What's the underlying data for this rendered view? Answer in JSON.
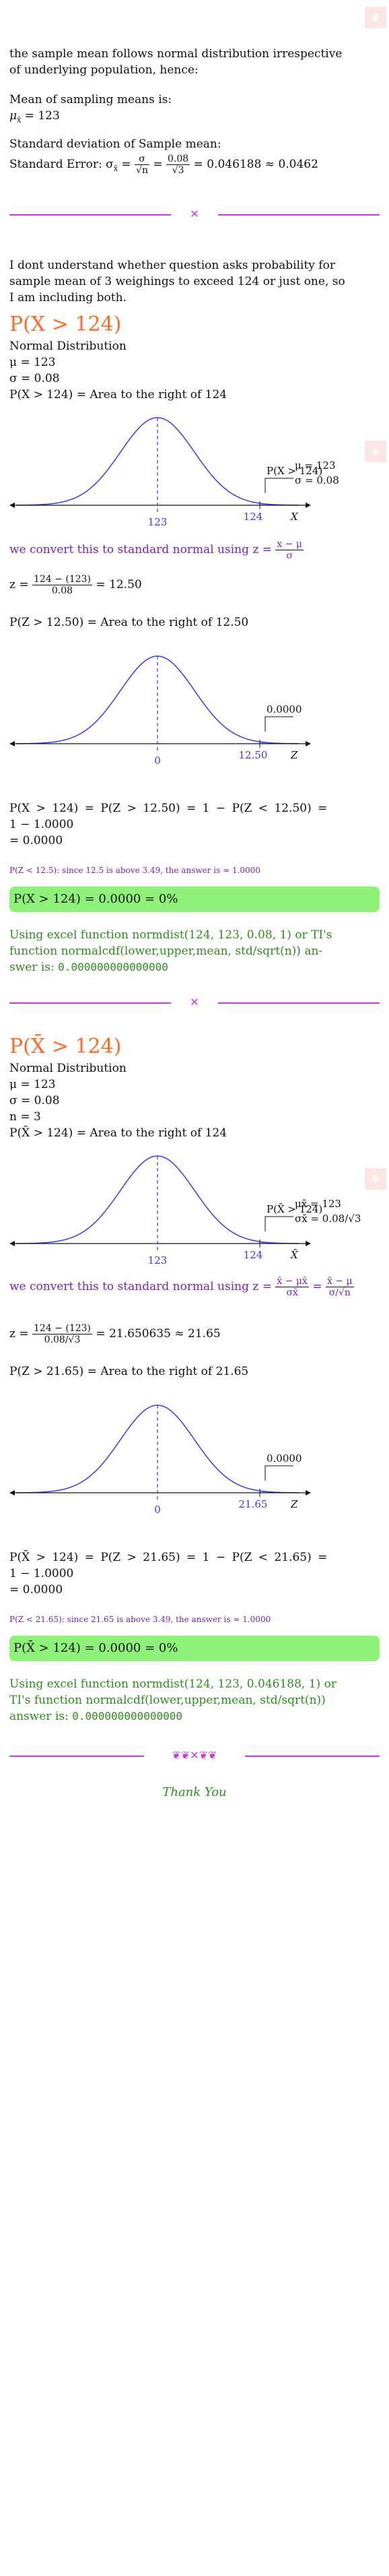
{
  "intro": {
    "line1": "the sample mean follows normal distribution irrespective",
    "line2": "of underlying population, hence:",
    "mean_label": "Mean of sampling means is:",
    "mean_value": "μ",
    "mean_sub": "x̄",
    "mean_eq": " = 123",
    "sd_label": "Standard deviation of Sample mean:",
    "se_label": "Standard Error: σ",
    "se_sub": "x̄",
    "se_eq": " = ",
    "se_frac1_num": "σ",
    "se_frac1_den": "√n",
    "se_frac2_num": "0.08",
    "se_frac2_den": "√3",
    "se_result": " = 0.046188 ≈ 0.0462"
  },
  "note": {
    "line1": "I dont understand whether question asks probability for",
    "line2": "sample mean of 3 weighings to exceed 124 or just one, so",
    "line3": "I am including both."
  },
  "part1": {
    "heading": "P(X > 124)",
    "dist": "Normal Distribution",
    "mu": "μ = 123",
    "sigma": "σ = 0.08",
    "area": "P(X > 124) = Area to the right of 124",
    "graph1": {
      "mean_label": "123",
      "value_label": "124",
      "axis": "X",
      "legend_mu": "μ = 123",
      "legend_sigma": "σ = 0.08",
      "arrow_label": "P(X > 124)"
    },
    "convert": "we convert this to standard normal using z = ",
    "convert_num": "x − μ",
    "convert_den": "σ",
    "z_lhs": "z = ",
    "z_num": "124 − (123)",
    "z_den": "0.08",
    "z_result": " = 12.50",
    "pz_area": "P(Z > 12.50) = Area to the right of 12.50",
    "graph2": {
      "mean_label": "0",
      "value_label": "12.50",
      "axis": "Z",
      "arrow_label": "0.0000"
    },
    "calc_line1": "P(X > 124) = P(Z > 12.50) = 1 − P(Z < 12.50) =",
    "calc_line2": "1 − 1.0000",
    "calc_line3": "= 0.0000",
    "small_note": "P(Z < 12.5): since 12.5 is above 3.49, the answer is ≈ 1.0000",
    "result": "P(X > 124) = 0.0000 = 0%",
    "excel_line1": "Using excel function normdist(124, 123, 0.08, 1) or TI's",
    "excel_line2": "function normalcdf(lower,upper,mean, std/sqrt(n)) an-",
    "excel_line3": "swer is: ",
    "excel_answer": "0.000000000000000"
  },
  "part2": {
    "heading": "P(X̄ > 124)",
    "dist": "Normal Distribution",
    "mu": "μ = 123",
    "sigma": "σ = 0.08",
    "n": "n = 3",
    "area": "P(X̄ > 124) = Area to the right of 124",
    "graph1": {
      "mean_label": "123",
      "value_label": "124",
      "axis": "X̄",
      "legend_mu": "μx̄ = 123",
      "legend_sigma": "σx̄ = 0.08/√3",
      "arrow_label": "P(X̄ > 124)"
    },
    "convert": "we convert this to standard normal using z = ",
    "convert_num": "x̄ − μx̄",
    "convert_den": "σx̄",
    "convert_eq": " =",
    "convert2_num": "x̄ − μ",
    "convert2_den": "σ/√n",
    "z_lhs": "z = ",
    "z_num": "124 − (123)",
    "z_den": "0.08/√3",
    "z_result": " = 21.650635 ≈ 21.65",
    "pz_area": "P(Z > 21.65) = Area to the right of 21.65",
    "graph2": {
      "mean_label": "0",
      "value_label": "21.65",
      "axis": "Z",
      "arrow_label": "0.0000"
    },
    "calc_line1": "P(X̄ > 124) = P(Z > 21.65) = 1 − P(Z < 21.65) =",
    "calc_line2": "1 − 1.0000",
    "calc_line3": "= 0.0000",
    "small_note": "P(Z < 21.65): since 21.65 is above 3.49, the answer is ≈ 1.0000",
    "result": "P(X̄ > 124) = 0.0000 = 0%",
    "excel_line1": "Using excel function normdist(124, 123, 0.046188, 1) or",
    "excel_line2": "TI's function normalcdf(lower,upper,mean, std/sqrt(n))",
    "excel_line3": "answer is: ",
    "excel_answer": "0.000000000000000"
  },
  "footer": {
    "thanks": "Thank You"
  },
  "colors": {
    "curve": "#3a3ae6",
    "accent": "#ff6a2a",
    "purple": "#7d1fb1",
    "green": "#2e8b1e",
    "highlight": "#8ef27a",
    "divider": "#c23fd1"
  }
}
